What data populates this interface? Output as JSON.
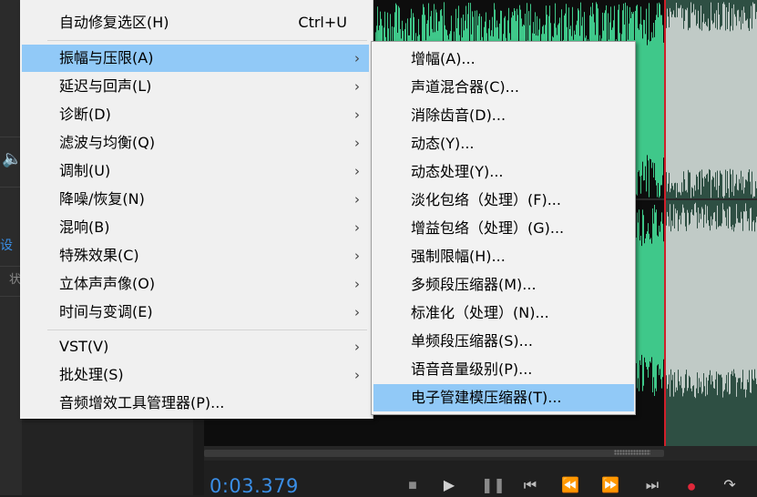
{
  "main_menu": {
    "items": [
      {
        "label": "自动修复选区(H)",
        "shortcut": "Ctrl+U"
      },
      {
        "label": "振幅与压限(A)",
        "arrow": "›"
      },
      {
        "label": "延迟与回声(L)",
        "arrow": "›"
      },
      {
        "label": "诊断(D)",
        "arrow": "›"
      },
      {
        "label": "滤波与均衡(Q)",
        "arrow": "›"
      },
      {
        "label": "调制(U)",
        "arrow": "›"
      },
      {
        "label": "降噪/恢复(N)",
        "arrow": "›"
      },
      {
        "label": "混响(B)",
        "arrow": "›"
      },
      {
        "label": "特殊效果(C)",
        "arrow": "›"
      },
      {
        "label": "立体声声像(O)",
        "arrow": "›"
      },
      {
        "label": "时间与变调(E)",
        "arrow": "›"
      },
      {
        "label": "VST(V)",
        "arrow": "›"
      },
      {
        "label": "批处理(S)",
        "arrow": "›"
      },
      {
        "label": "音频增效工具管理器(P)..."
      }
    ]
  },
  "submenu": {
    "items": [
      {
        "label": "增幅(A)..."
      },
      {
        "label": "声道混合器(C)..."
      },
      {
        "label": "消除齿音(D)..."
      },
      {
        "label": "动态(Y)..."
      },
      {
        "label": "动态处理(Y)..."
      },
      {
        "label": "淡化包络（处理）(F)..."
      },
      {
        "label": "增益包络（处理）(G)..."
      },
      {
        "label": "强制限幅(H)..."
      },
      {
        "label": "多频段压缩器(M)..."
      },
      {
        "label": "标准化（处理）(N)..."
      },
      {
        "label": "单频段压缩器(S)..."
      },
      {
        "label": "语音音量级别(P)..."
      },
      {
        "label": "电子管建模压缩器(T)..."
      }
    ]
  },
  "transport": {
    "timecode": "0:03.379"
  },
  "background": {
    "settings_label": "设置",
    "settings_label2": "状"
  },
  "colors": {
    "menu_highlight": "#91c9f7",
    "waveform_green": "#3fc88a",
    "waveform_selected_bg": "#2e4f43",
    "timecode_blue": "#3a8ee6",
    "record_red": "#e0283a",
    "playhead_red": "#d0202a"
  }
}
